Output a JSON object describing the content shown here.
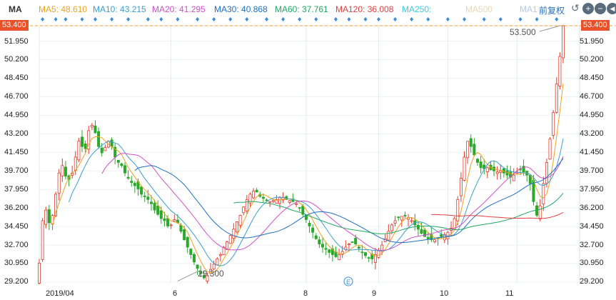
{
  "legend": {
    "ma_label": "MA",
    "items": [
      {
        "text": "MA5: 48.610",
        "color": "#f0a020"
      },
      {
        "text": "MA10: 43.215",
        "color": "#3a9fd0"
      },
      {
        "text": "MA20: 41.295",
        "color": "#d050c8"
      },
      {
        "text": "MA30: 40.868",
        "color": "#2070c0"
      },
      {
        "text": "MA60: 37.761",
        "color": "#20a860"
      },
      {
        "text": "MA120: 36.008",
        "color": "#e04040"
      },
      {
        "text": "MA250:",
        "color": "#40c8e0"
      },
      {
        "text": "MA500",
        "color": "#e8d8b8"
      },
      {
        "text": "MA1",
        "color": "#b8c8e0"
      }
    ],
    "adjust_label": "前复权",
    "controls": [
      "undo-icon",
      "zoom-in-icon",
      "zoom-out-icon",
      "scroll-left-icon",
      "scroll-right-icon"
    ]
  },
  "price_badge": "53.400",
  "chart_data": {
    "type": "candlestick",
    "y_ticks": [
      "51.950",
      "50.200",
      "48.450",
      "46.700",
      "44.950",
      "43.200",
      "41.450",
      "39.700",
      "37.950",
      "36.200",
      "34.450",
      "32.700",
      "30.950",
      "29.200"
    ],
    "ylim": [
      29.2,
      53.4
    ],
    "x_ticks": [
      {
        "label": "2019/04",
        "index": 0
      },
      {
        "label": "6",
        "index": 40
      },
      {
        "label": "8",
        "index": 81
      },
      {
        "label": "9",
        "index": 103
      },
      {
        "label": "10",
        "index": 124
      },
      {
        "label": "11",
        "index": 145
      }
    ],
    "low_annotation": {
      "text": "29.300",
      "index": 42,
      "value": 29.3
    },
    "high_annotation": {
      "text": "53.500",
      "index": 158,
      "value": 53.4
    },
    "closes": [
      31.0,
      35.0,
      36.0,
      34.8,
      35.5,
      37.5,
      39.5,
      40.2,
      39.2,
      38.9,
      39.5,
      41.0,
      42.5,
      42.0,
      41.8,
      43.5,
      44.0,
      43.3,
      42.0,
      41.4,
      41.9,
      42.5,
      42.0,
      41.0,
      40.5,
      40.2,
      39.5,
      39.0,
      38.6,
      38.3,
      38.0,
      37.5,
      37.3,
      37.0,
      36.6,
      36.0,
      35.6,
      35.2,
      35.0,
      34.5,
      34.6,
      35.1,
      34.8,
      34.0,
      33.2,
      32.5,
      31.8,
      31.1,
      30.5,
      30.0,
      29.6,
      29.8,
      30.4,
      30.9,
      31.4,
      31.8,
      32.5,
      33.0,
      33.6,
      34.2,
      34.9,
      35.5,
      36.3,
      37.0,
      37.5,
      37.8,
      37.7,
      37.3,
      37.1,
      36.9,
      36.8,
      36.9,
      37.0,
      37.2,
      37.2,
      37.0,
      36.9,
      36.8,
      36.6,
      36.2,
      35.6,
      35.1,
      34.5,
      33.9,
      33.3,
      32.8,
      32.5,
      32.3,
      32.0,
      31.8,
      31.6,
      31.8,
      32.1,
      32.5,
      32.8,
      33.0,
      32.8,
      32.4,
      32.0,
      31.7,
      31.5,
      31.4,
      31.8,
      32.2,
      32.7,
      33.3,
      34.0,
      34.6,
      35.0,
      35.3,
      35.4,
      35.5,
      35.3,
      35.0,
      34.6,
      34.2,
      33.8,
      33.5,
      33.3,
      33.2,
      33.2,
      33.3,
      33.5,
      33.7,
      33.9,
      34.3,
      35.2,
      37.0,
      39.0,
      41.0,
      42.5,
      42.0,
      41.2,
      40.5,
      40.0,
      39.9,
      40.0,
      39.8,
      39.7,
      39.6,
      39.7,
      39.5,
      39.3,
      39.1,
      39.3,
      39.6,
      39.8,
      39.6,
      39.3,
      38.5,
      36.8,
      35.5,
      36.4,
      38.5,
      40.5,
      42.7,
      45.2,
      47.9,
      50.5,
      53.4
    ],
    "ma_values": {
      "MA5": 48.61,
      "MA10": 43.215,
      "MA20": 41.295,
      "MA30": 40.868,
      "MA60": 37.761,
      "MA120": 36.008
    }
  }
}
